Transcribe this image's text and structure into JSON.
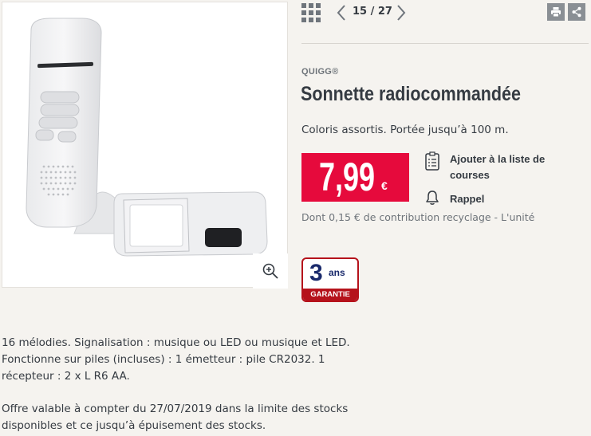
{
  "nav": {
    "pager": "15 / 27"
  },
  "product": {
    "brand": "QUIGG®",
    "title": "Sonnette radiocommandée",
    "subtitle": "Coloris assortis. Portée jusqu’à 100 m.",
    "price_main": "7,99",
    "price_currency": "€",
    "recycle_note": "Dont 0,15 € de contribution recyclage - L'unité"
  },
  "actions": {
    "shopping_list_line1": "Ajouter à la liste de",
    "shopping_list_line2": "courses",
    "reminder": "Rappel"
  },
  "warranty": {
    "number": "3",
    "unit": "ans",
    "label": "GARANTIE"
  },
  "description": {
    "details": "16 mélodies. Signalisation : musique ou LED ou musique et LED. Fonctionne sur piles (incluses) : 1 émetteur : pile CR2032. 1 récepteur : 2 x L R6 AA.",
    "offer": "Offre valable à compter du 27/07/2019 dans la limite des stocks disponibles et ce jusqu’à épuisement des stocks."
  },
  "colors": {
    "price_red": "#e60a3c",
    "warranty_red": "#b5121b",
    "warranty_navy": "#1a2a6c",
    "text_dark": "#353b42",
    "icon_gray": "#8a8f94"
  },
  "icons": {
    "grid": "grid-view-icon",
    "prev": "chevron-left-icon",
    "next": "chevron-right-icon",
    "print": "print-icon",
    "share": "share-icon",
    "zoom": "zoom-in-icon",
    "list": "clipboard-list-icon",
    "bell": "bell-icon"
  }
}
